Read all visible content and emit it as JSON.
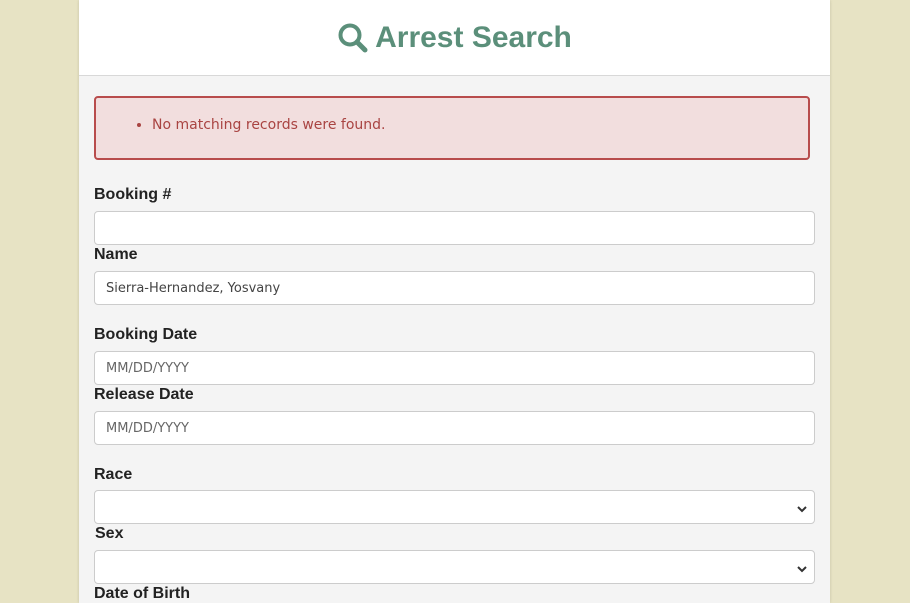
{
  "header": {
    "title": "Arrest Search",
    "icon": "search-icon",
    "title_color": "#5b8f7a"
  },
  "alert": {
    "messages": [
      "No matching records were found."
    ],
    "background": "#f2dede",
    "border": "#b84c4c",
    "text_color": "#a94442"
  },
  "form": {
    "booking_number": {
      "label": "Booking #",
      "value": "",
      "placeholder": ""
    },
    "name": {
      "label": "Name",
      "value": "Sierra-Hernandez, Yosvany",
      "placeholder": ""
    },
    "booking_date": {
      "label": "Booking Date",
      "value": "",
      "placeholder": "MM/DD/YYYY"
    },
    "release_date": {
      "label": "Release Date",
      "value": "",
      "placeholder": "MM/DD/YYYY"
    },
    "race": {
      "label": "Race",
      "value": ""
    },
    "sex": {
      "label": "Sex",
      "value": ""
    },
    "date_of_birth": {
      "label": "Date of Birth"
    }
  },
  "page_background": "#e7e3c4"
}
